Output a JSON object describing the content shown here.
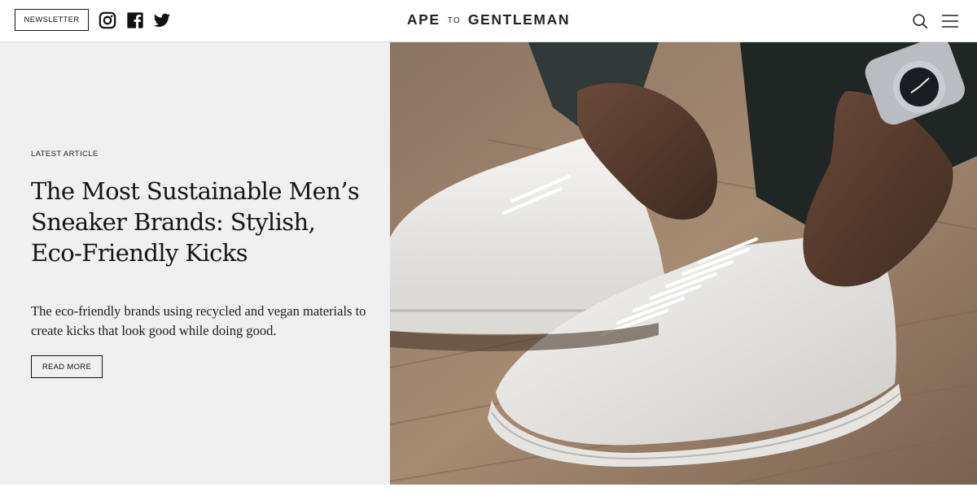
{
  "header": {
    "newsletter_label": "NEWSLETTER",
    "logo_left": "APE",
    "logo_to": "TO",
    "logo_right": "GENTLEMAN",
    "social_icons": [
      "instagram-icon",
      "facebook-icon",
      "twitter-icon"
    ],
    "right_icons": [
      "search-icon",
      "hamburger-menu-icon"
    ]
  },
  "feature": {
    "eyebrow": "LATEST ARTICLE",
    "headline": "The Most Sustainable Men’s Sneaker Brands: Stylish, Eco-Friendly Kicks",
    "dek": "The eco-friendly brands using recycled and vegan materials to create kicks that look good while doing good.",
    "read_more_label": "READ MORE"
  },
  "colors": {
    "panel_bg": "#f0f0f0",
    "text": "#151515",
    "border": "#111111"
  }
}
